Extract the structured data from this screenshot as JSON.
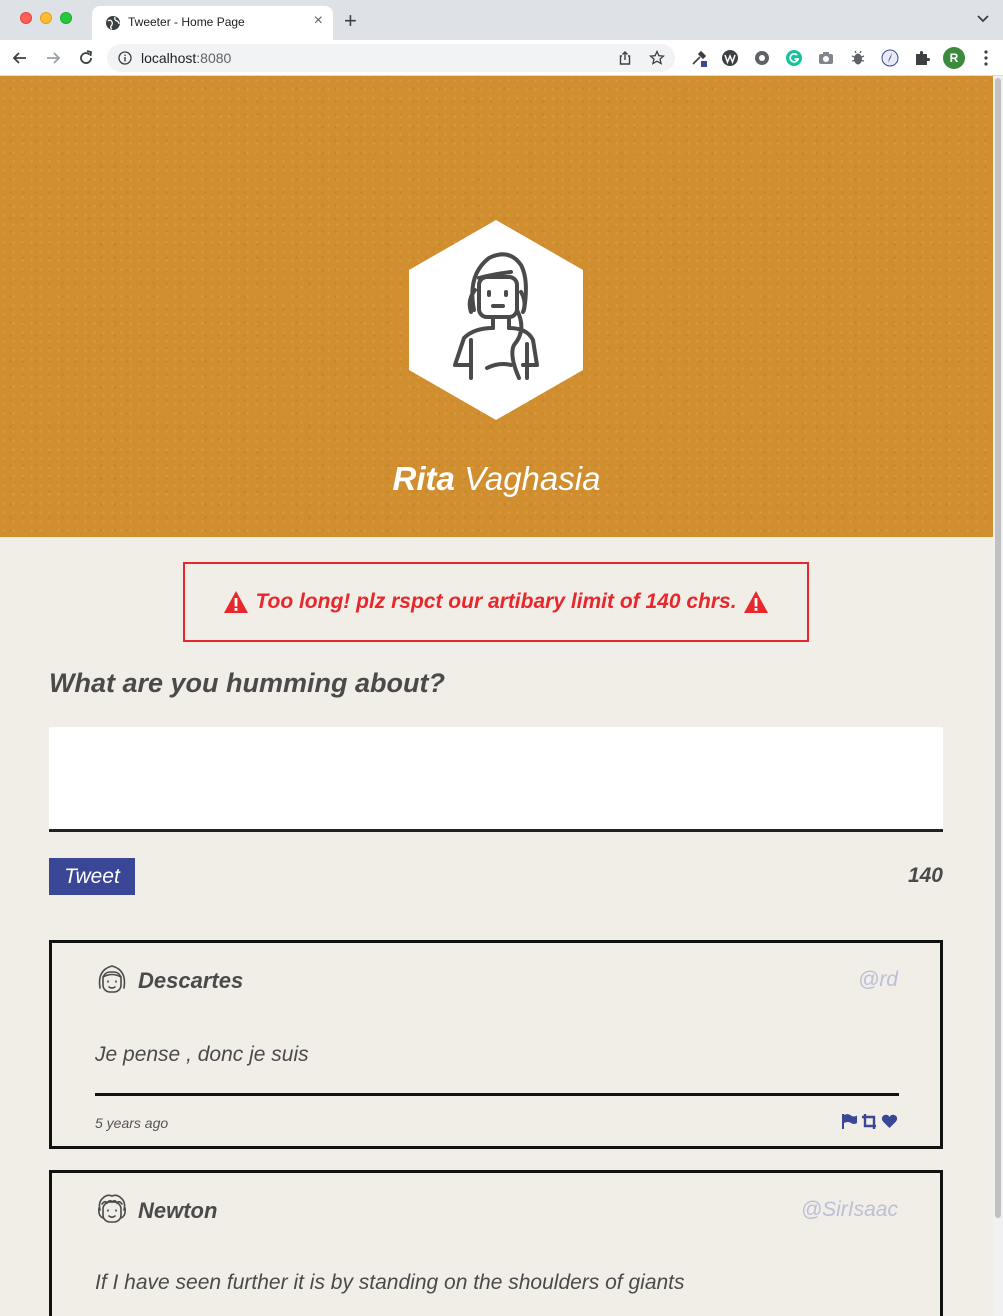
{
  "browser": {
    "tab_title": "Tweeter - Home Page",
    "tab_close": "×",
    "new_tab": "+",
    "url_host": "localhost",
    "url_port": ":8080",
    "profile_initial": "R"
  },
  "profile": {
    "first_name": "Rita",
    "last_name": "Vaghasia"
  },
  "error": {
    "message": "Too long! plz rspct our artibary limit of 140 chrs.",
    "color": "#e8262b"
  },
  "compose": {
    "prompt": "What are you humming about?",
    "text": "",
    "button_label": "Tweet",
    "counter": "140"
  },
  "tweets": [
    {
      "name": "Descartes",
      "handle": "@rd",
      "content": "Je pense , donc je suis",
      "time": "5 years ago",
      "avatar_icon": "girl-avatar-icon"
    },
    {
      "name": "Newton",
      "handle": "@SirIsaac",
      "content": "If I have seen further it is by standing on the shoulders of giants",
      "avatar_icon": "man-avatar-icon"
    }
  ],
  "colors": {
    "header_bg": "#d08e2e",
    "accent": "#3a4796",
    "page_bg": "#f1eee8"
  }
}
